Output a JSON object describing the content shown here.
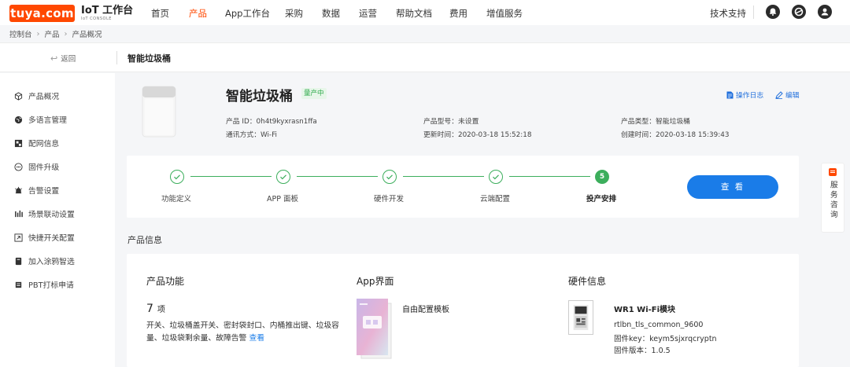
{
  "brand": {
    "logo_text": "tuya.com",
    "title": "IoT 工作台",
    "subtitle": "IoT CONSOLE"
  },
  "nav": {
    "items": [
      {
        "label": "首页",
        "active": false
      },
      {
        "label": "产品",
        "active": true
      },
      {
        "label": "App工作台",
        "active": false
      },
      {
        "label": "采购",
        "active": false
      },
      {
        "label": "数据",
        "active": false
      },
      {
        "label": "运营",
        "active": false
      },
      {
        "label": "帮助文档",
        "active": false
      },
      {
        "label": "费用",
        "active": false
      },
      {
        "label": "增值服务",
        "active": false
      }
    ],
    "tech_support": "技术支持",
    "icons": [
      "bell-icon",
      "circle-logo-icon",
      "user-icon"
    ]
  },
  "breadcrumb": [
    "控制台",
    "产品",
    "产品概况"
  ],
  "subheader": {
    "back_label": "返回",
    "title": "智能垃圾桶"
  },
  "sidebar": {
    "items": [
      {
        "label": "产品概况",
        "icon": "cube-icon"
      },
      {
        "label": "多语言管理",
        "icon": "globe-icon"
      },
      {
        "label": "配网信息",
        "icon": "network-icon"
      },
      {
        "label": "固件升级",
        "icon": "firmware-icon"
      },
      {
        "label": "告警设置",
        "icon": "alarm-icon"
      },
      {
        "label": "场景联动设置",
        "icon": "scene-icon"
      },
      {
        "label": "快捷开关配置",
        "icon": "switch-icon"
      },
      {
        "label": "加入涂鸦智选",
        "icon": "store-icon"
      },
      {
        "label": "PBT打标申请",
        "icon": "tag-icon"
      }
    ]
  },
  "service_tab": {
    "label": "服务咨询"
  },
  "product": {
    "name": "智能垃圾桶",
    "status_badge": "量产中",
    "actions": {
      "log": "操作日志",
      "edit": "编辑"
    },
    "meta": {
      "product_id": "产品 ID：0h4t9kyxrasn1ffa",
      "comm_method": "通讯方式：Wi-Fi",
      "model": "产品型号：未设置",
      "updated": "更新时间：2020-03-18 15:52:18",
      "type": "产品类型：智能垃圾桶",
      "created": "创建时间：2020-03-18 15:39:43"
    }
  },
  "steps": {
    "items": [
      {
        "label": "功能定义",
        "state": "done"
      },
      {
        "label": "APP 面板",
        "state": "done"
      },
      {
        "label": "硬件开发",
        "state": "done"
      },
      {
        "label": "云端配置",
        "state": "done"
      },
      {
        "label": "投产安排",
        "state": "current",
        "number": "5"
      }
    ],
    "view_button": "查 看",
    "color": "#3cae5c"
  },
  "section_title": "产品信息",
  "info": {
    "features": {
      "title": "产品功能",
      "count": "7",
      "unit": "项",
      "list": "开关、垃圾桶盖开关、密封袋封口、内桶推出键、垃圾容量、垃圾袋剩余量、故障告警",
      "link": "查看"
    },
    "app": {
      "title": "App界面",
      "template": "自由配置模板"
    },
    "hardware": {
      "title": "硬件信息",
      "module": "WR1 Wi-Fi模块",
      "firmware_name": "rtlbn_tls_common_9600",
      "firmware_key": "固件key：keym5sjxrqcryptn",
      "firmware_version": "固件版本：1.0.5"
    }
  },
  "colors": {
    "brand": "#ff4800",
    "link": "#1a7ce8",
    "success": "#3cae5c"
  }
}
